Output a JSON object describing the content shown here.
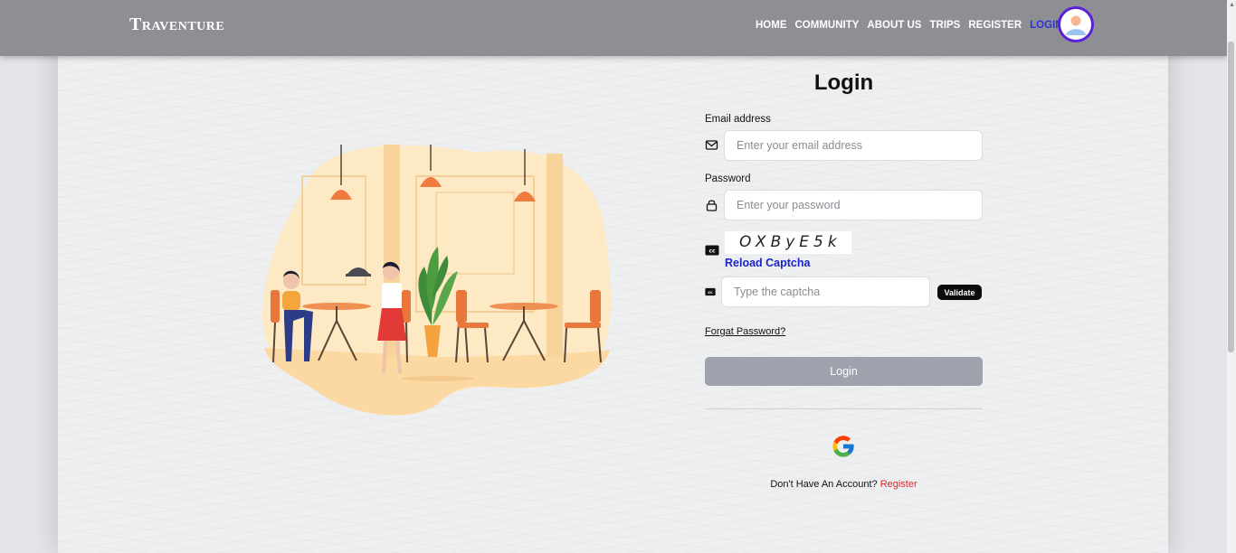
{
  "navbar": {
    "brand": "Traventure",
    "links": [
      {
        "label": "HOME",
        "active": false
      },
      {
        "label": "COMMUNITY",
        "active": false
      },
      {
        "label": "ABOUT US",
        "active": false
      },
      {
        "label": "TRIPS",
        "active": false
      },
      {
        "label": "REGISTER",
        "active": false
      },
      {
        "label": "LOGIN",
        "active": true
      }
    ],
    "avatar_icon": "user-avatar-icon"
  },
  "login": {
    "title": "Login",
    "email": {
      "label": "Email address",
      "placeholder": "Enter your email address",
      "value": "",
      "icon": "envelope-icon"
    },
    "password": {
      "label": "Password",
      "placeholder": "Enter your password",
      "value": "",
      "icon": "lock-icon"
    },
    "captcha": {
      "text": "OXByE5k",
      "reload_label": "Reload Captcha",
      "icon": "cc-icon",
      "input_placeholder": "Type the captcha",
      "validate_label": "Validate"
    },
    "forgot_label": "Forgat Password?",
    "submit_label": "Login",
    "google_icon": "google-icon",
    "signup_prompt": "Don't Have An Account?",
    "signup_link": "Register"
  },
  "colors": {
    "navbar_bg": "#8e8f94",
    "active_link": "#2b34d6",
    "avatar_border": "#5b21d6",
    "login_button": "#9ea2ad",
    "register_link": "#e0262b",
    "reload_link": "#1a24c8"
  }
}
